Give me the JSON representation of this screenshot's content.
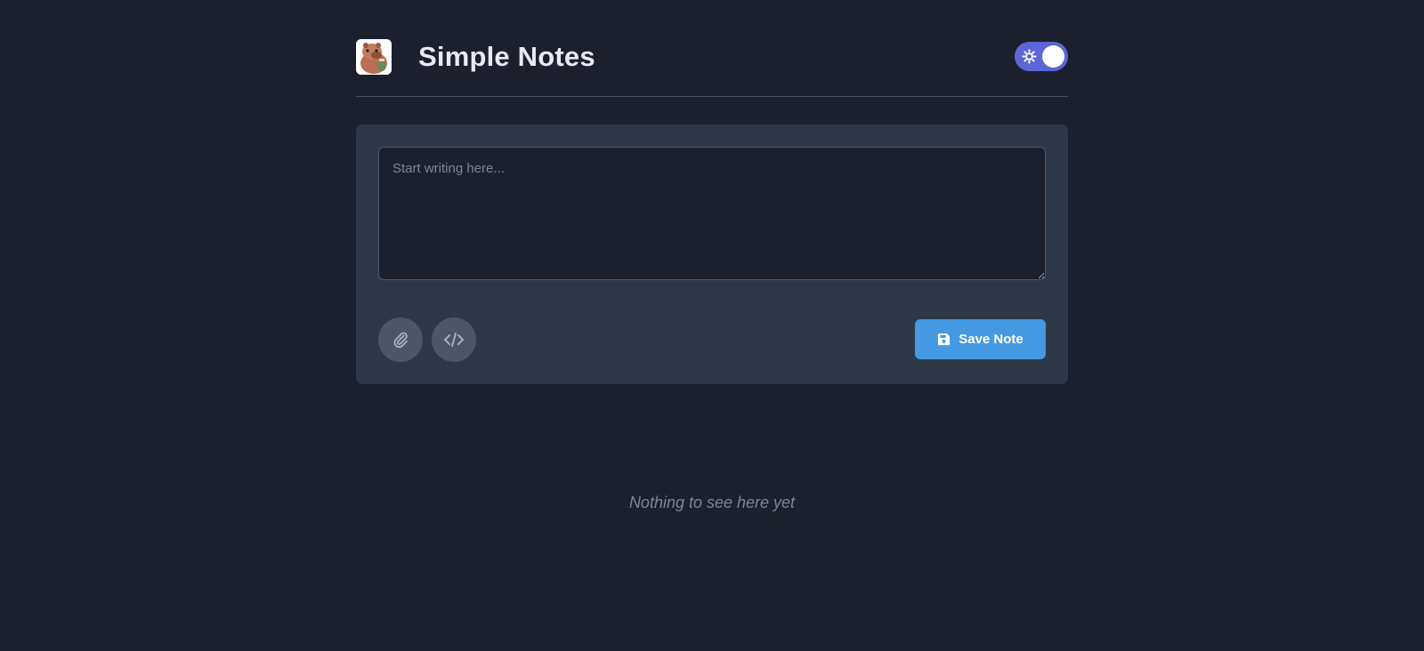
{
  "header": {
    "title": "Simple Notes",
    "logo_icon": "capybara-logo-icon",
    "theme_toggle": {
      "icon": "sun-icon",
      "state": "dark"
    }
  },
  "editor": {
    "placeholder": "Start writing here...",
    "value": "",
    "attach_icon": "paperclip-icon",
    "code_icon": "code-icon",
    "save_icon": "floppy-disk-icon",
    "save_label": "Save Note"
  },
  "notes": {
    "empty_message": "Nothing to see here yet"
  },
  "colors": {
    "background": "#1b202c",
    "card": "#2f3849",
    "accent": "#4499e2",
    "toggle": "#5b67d8",
    "title": "#e7eaf6"
  }
}
